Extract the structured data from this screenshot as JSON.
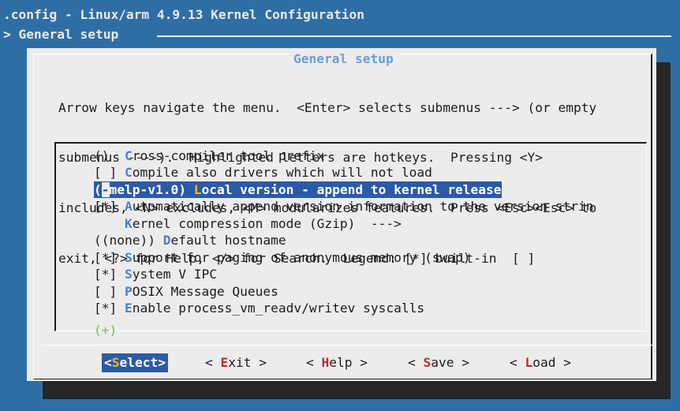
{
  "window": {
    "title": ".config - Linux/arm 4.9.13 Kernel Configuration",
    "breadcrumb": "> General setup"
  },
  "dialog": {
    "title": "General setup",
    "help_lines": [
      "Arrow keys navigate the menu.  <Enter> selects submenus ---> (or empty",
      "submenus ----).  Highlighted letters are hotkeys.  Pressing <Y>",
      "includes, <N> excludes, <M> modularizes features.  Press <Esc><Esc> to",
      "exit, <?> for Help, </> for Search.  Legend: [*] built-in  [ ]"
    ]
  },
  "menu": {
    "items": [
      {
        "prefix": "()  ",
        "hotkey": "C",
        "rest": "ross-compiler tool prefix",
        "selected": false
      },
      {
        "prefix": "[ ] ",
        "hotkey": "C",
        "rest": "ompile also drivers which will not load",
        "selected": false
      },
      {
        "prefix": "(-melp-v1.0) ",
        "hotkey": "L",
        "rest": "ocal version - append to kernel release",
        "selected": true
      },
      {
        "prefix": "[*] ",
        "hotkey": "A",
        "rest": "utomatically append version information to the version strin",
        "selected": false
      },
      {
        "prefix": "    ",
        "hotkey": "K",
        "rest": "ernel compression mode (Gzip)  --->",
        "selected": false
      },
      {
        "prefix": "((none)) ",
        "hotkey": "D",
        "rest": "efault hostname",
        "selected": false
      },
      {
        "prefix": "[*] ",
        "hotkey": "S",
        "rest": "upport for paging of anonymous memory (swap)",
        "selected": false
      },
      {
        "prefix": "[*] ",
        "hotkey": "S",
        "rest": "ystem V IPC",
        "selected": false
      },
      {
        "prefix": "[ ] ",
        "hotkey": "P",
        "rest": "OSIX Message Queues",
        "selected": false
      },
      {
        "prefix": "[*] ",
        "hotkey": "E",
        "rest": "nable process_vm_readv/writev syscalls",
        "selected": false
      }
    ],
    "more_indicator": "(+)"
  },
  "buttons": [
    {
      "pre": "<",
      "hotkey": "S",
      "rest": "elect>",
      "active": true
    },
    {
      "pre": "< ",
      "hotkey": "E",
      "rest": "xit >",
      "active": false
    },
    {
      "pre": "< ",
      "hotkey": "H",
      "rest": "elp >",
      "active": false
    },
    {
      "pre": "< ",
      "hotkey": "S",
      "rest": "ave >",
      "active": false
    },
    {
      "pre": "< ",
      "hotkey": "L",
      "rest": "oad >",
      "active": false
    }
  ]
}
